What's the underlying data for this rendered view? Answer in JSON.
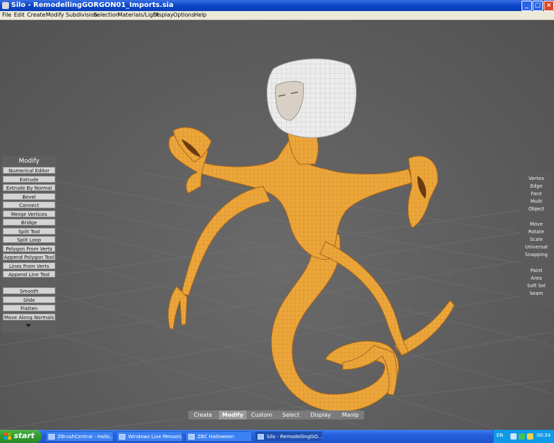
{
  "window": {
    "title": "Silo - RemodellingGORGON01_Imports.sia"
  },
  "menubar": {
    "items": [
      "File",
      "Edit",
      "Create",
      "Modify",
      "Subdivision",
      "Selection",
      "Materials/Light",
      "Display",
      "Options",
      "Help"
    ]
  },
  "modify_panel": {
    "title": "Modify",
    "tools": [
      "Numerical Editor",
      "Extrude",
      "Extrude By Normal",
      "Bevel",
      "Connect",
      "Merge Vertices",
      "Bridge",
      "Split Tool",
      "Split Loop",
      "Polygon From Verts",
      "Append Polygon Tool",
      "Lines From Verts",
      "Append Line Tool"
    ],
    "tools2": [
      "Smooth",
      "Slide",
      "Flatten",
      "Move Along Normals"
    ]
  },
  "selection_panel": {
    "modes": [
      "Vertex",
      "Edge",
      "Face",
      "Multi",
      "Object"
    ],
    "active_mode": "Object",
    "transform": [
      "Move",
      "Rotate",
      "Scale",
      "Universal",
      "Snapping"
    ],
    "paint": [
      "Paint",
      "Area",
      "Soft Sel",
      "Seam"
    ]
  },
  "bottom_tabs": {
    "items": [
      "Create",
      "Modify",
      "Custom",
      "Select",
      "Display",
      "Manip"
    ],
    "active": "Modify"
  },
  "taskbar": {
    "start_label": "start",
    "tasks": [
      "ZBrushCentral - Hallo...",
      "Windows Live Messen...",
      "ZBC Halloween",
      "Silo - RemodellingGO..."
    ],
    "active_task": "Silo - RemodellingGO...",
    "lang": "EN",
    "clock": "00:34"
  },
  "colors": {
    "model": "#e8a236",
    "model_dark": "#b9741c",
    "head": "#e6e6e6",
    "viewport_bg": "#5e5e5e",
    "titlebar": "#0a46c8"
  }
}
